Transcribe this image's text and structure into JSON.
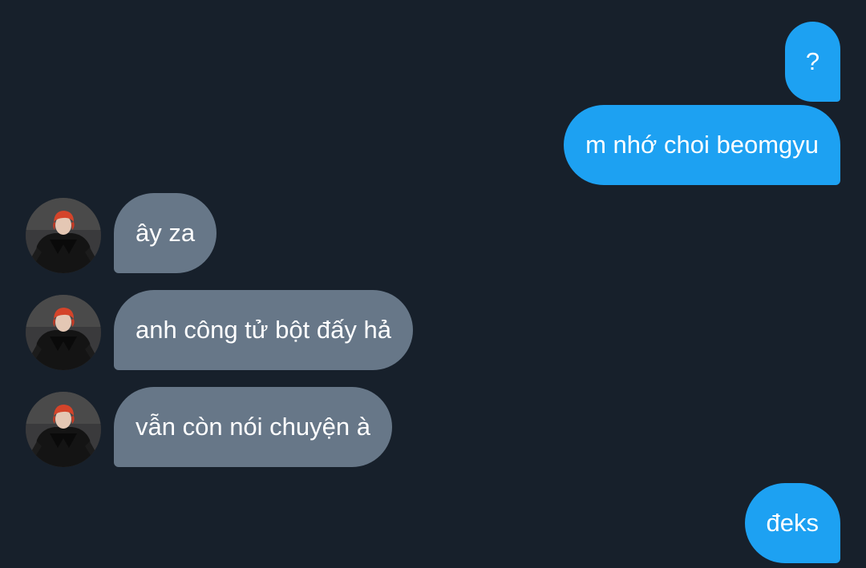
{
  "conversation": {
    "messages": [
      {
        "sender": "me",
        "text": "?"
      },
      {
        "sender": "me",
        "text": "m nhớ choi beomgyu"
      },
      {
        "sender": "other",
        "text": "ây za"
      },
      {
        "sender": "other",
        "text": "anh công tử bột đấy hả"
      },
      {
        "sender": "other",
        "text": "vẫn còn nói chuyện à"
      },
      {
        "sender": "me",
        "text": "đeks"
      }
    ]
  },
  "colors": {
    "background": "#17202b",
    "sent_bubble": "#1da1f2",
    "received_bubble": "#677788",
    "text": "#ffffff"
  },
  "icons": {
    "avatar": "contact-avatar-photo"
  }
}
